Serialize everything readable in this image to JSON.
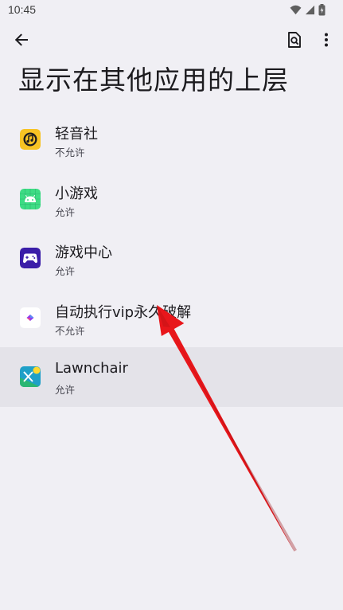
{
  "status_bar": {
    "time": "10:45",
    "icons": [
      "wifi-icon",
      "signal-icon",
      "battery-icon"
    ]
  },
  "toolbar": {
    "back_icon": "arrow-back-icon",
    "search_icon": "search-in-page-icon",
    "more_icon": "more-vert-icon"
  },
  "page": {
    "title": "显示在其他应用的上层"
  },
  "apps": [
    {
      "name": "轻音社",
      "status": "不允许",
      "icon": "music-note-icon",
      "icon_color": "#f7c324"
    },
    {
      "name": "小游戏",
      "status": "允许",
      "icon": "android-icon",
      "icon_color": "#3ddc84"
    },
    {
      "name": "游戏中心",
      "status": "允许",
      "icon": "gamepad-icon",
      "icon_color": "#3b1ea8"
    },
    {
      "name": "自动执行vip永久破解",
      "status": "不允许",
      "icon": "diamond-icon",
      "icon_color": "#ffffff"
    },
    {
      "name": "Lawnchair",
      "status": "允许",
      "icon": "lawnchair-icon",
      "icon_color": "#1fa0c8"
    }
  ],
  "colors": {
    "background": "#f0eff4",
    "highlight_row": "#e4e3e9",
    "arrow": "#e8161b"
  }
}
